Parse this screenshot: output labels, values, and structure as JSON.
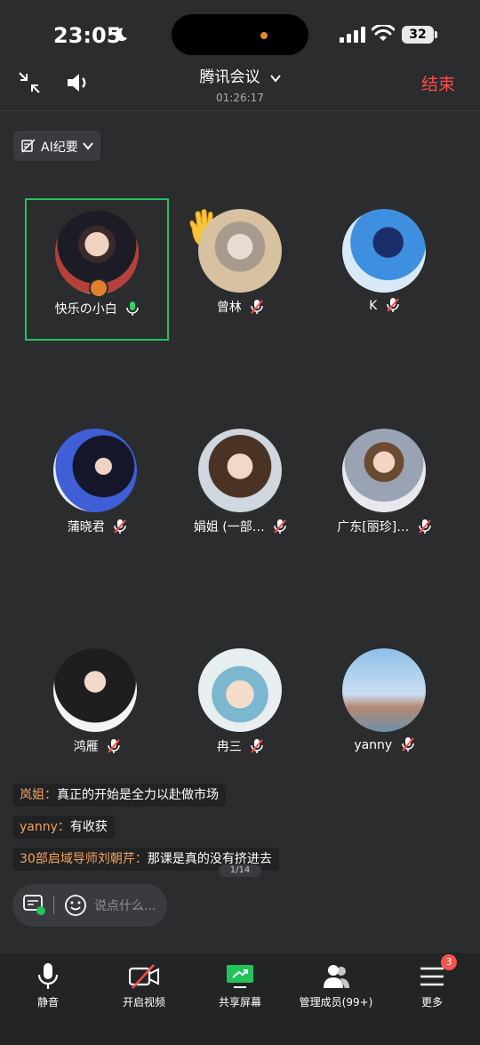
{
  "status_bar": {
    "time": "23:05",
    "battery": "32"
  },
  "header": {
    "title": "腾讯会议",
    "timer": "01:26:17",
    "end_label": "结束"
  },
  "ai_button": {
    "label": "AI纪要"
  },
  "participants": [
    {
      "name": "快乐の小白",
      "mic": "on",
      "active": true,
      "host": true
    },
    {
      "name": "曾林",
      "mic": "muted",
      "hand_raised": true
    },
    {
      "name": "K",
      "mic": "muted"
    },
    {
      "name": "蒲晓君",
      "mic": "muted"
    },
    {
      "name": "娟姐 (一部…",
      "mic": "muted"
    },
    {
      "name": "广东[丽珍]…",
      "mic": "muted"
    },
    {
      "name": "鸿雁",
      "mic": "muted"
    },
    {
      "name": "冉三",
      "mic": "muted"
    },
    {
      "name": "yanny",
      "mic": "muted"
    }
  ],
  "chat": [
    {
      "sender": "岚姐：",
      "text": "真正的开始是全力以赴做市场"
    },
    {
      "sender": "yanny：",
      "text": "有收获"
    },
    {
      "sender": "30部启域导师刘朝芹：",
      "text": "那课是真的没有挤进去"
    }
  ],
  "pager": "1/14",
  "input": {
    "placeholder": "说点什么..."
  },
  "toolbar": {
    "mute": "静音",
    "video": "开启视频",
    "share": "共享屏幕",
    "members": "管理成员(99+)",
    "more": "更多",
    "more_badge": "3"
  },
  "colors": {
    "active_border": "#23c35a",
    "end": "#ff4b4b",
    "sender": "#f3a25a",
    "badge": "#f5544f"
  }
}
